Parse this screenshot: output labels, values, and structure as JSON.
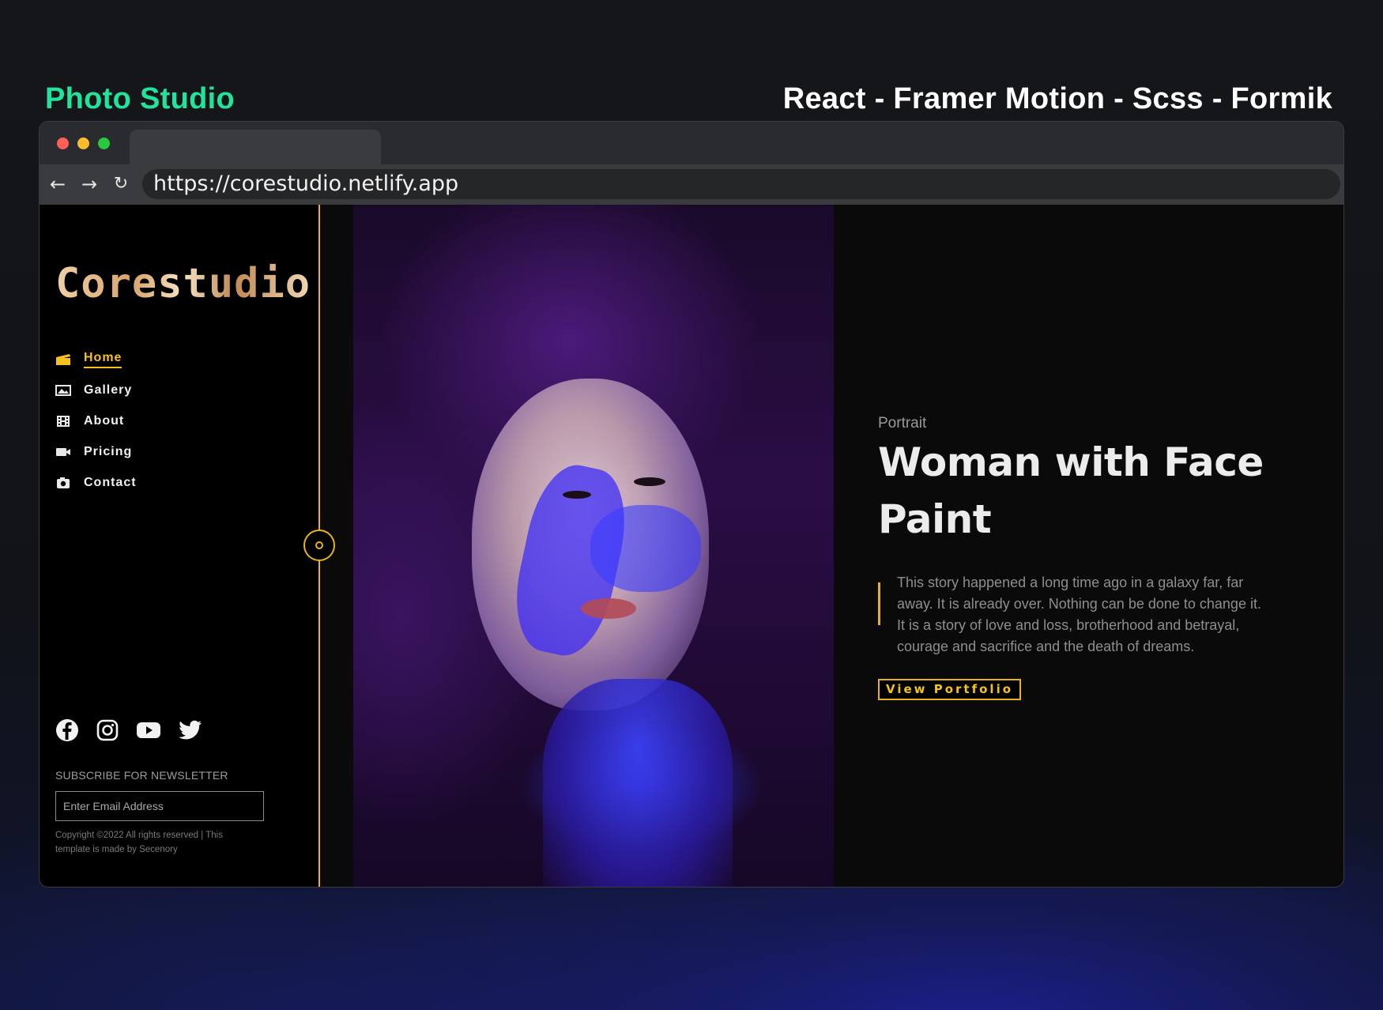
{
  "header": {
    "project_title": "Photo Studio",
    "tech_stack": "React - Framer Motion - Scss - Formik"
  },
  "browser": {
    "url": "https://corestudio.netlify.app",
    "back_icon": "arrow-left-icon",
    "forward_icon": "arrow-right-icon",
    "reload_icon": "reload-icon"
  },
  "sidebar": {
    "logo": "Corestudio",
    "menu": [
      {
        "label": "Home",
        "icon": "clapperboard-icon",
        "active": true
      },
      {
        "label": "Gallery",
        "icon": "image-icon",
        "active": false
      },
      {
        "label": "About",
        "icon": "film-icon",
        "active": false
      },
      {
        "label": "Pricing",
        "icon": "video-camera-icon",
        "active": false
      },
      {
        "label": "Contact",
        "icon": "camera-icon",
        "active": false
      }
    ],
    "social": [
      "facebook-icon",
      "instagram-icon",
      "youtube-icon",
      "twitter-icon"
    ],
    "newsletter_label": "SUBSCRIBE FOR NEWSLETTER",
    "email_placeholder": "Enter Email Address",
    "copyright": "Copyright ©2022 All rights reserved | This template is made by Secenory"
  },
  "hero": {
    "category": "Portrait",
    "title": "Woman with Face Paint",
    "description": "This story happened a long time ago in a galaxy far, far away. It is already over. Nothing can be done to change it. It is a story of love and loss, brotherhood and betrayal, courage and sacrifice and the death of dreams.",
    "cta_label": "View Portfolio"
  },
  "colors": {
    "accent": "#e6b31e",
    "title_green": "#22e39b",
    "background": "#000000"
  }
}
